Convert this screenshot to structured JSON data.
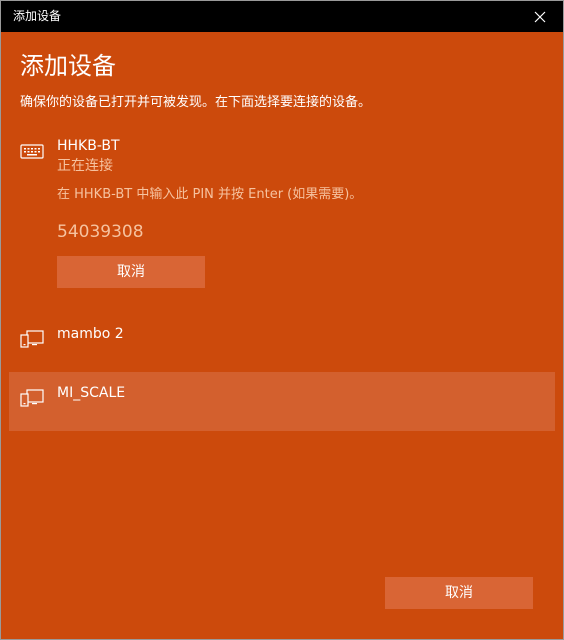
{
  "window": {
    "title": "添加设备"
  },
  "dialog": {
    "heading": "添加设备",
    "subtitle": "确保你的设备已打开并可被发现。在下面选择要连接的设备。"
  },
  "devices": [
    {
      "name": "HHKB-BT",
      "icon": "keyboard-icon",
      "status": "正在连接",
      "pin_instruction": "在 HHKB-BT 中输入此 PIN 并按 Enter (如果需要)。",
      "pin_code": "54039308",
      "cancel_label": "取消"
    },
    {
      "name": "mambo 2",
      "icon": "generic-device-icon"
    },
    {
      "name": "MI_SCALE",
      "icon": "generic-device-icon",
      "selected": true
    }
  ],
  "footer": {
    "cancel_label": "取消"
  },
  "colors": {
    "accent": "#cc4a0c",
    "titlebar": "#000000",
    "button": "#d96535",
    "muted_text": "#f6c29f",
    "selected_row": "#d3602e"
  }
}
